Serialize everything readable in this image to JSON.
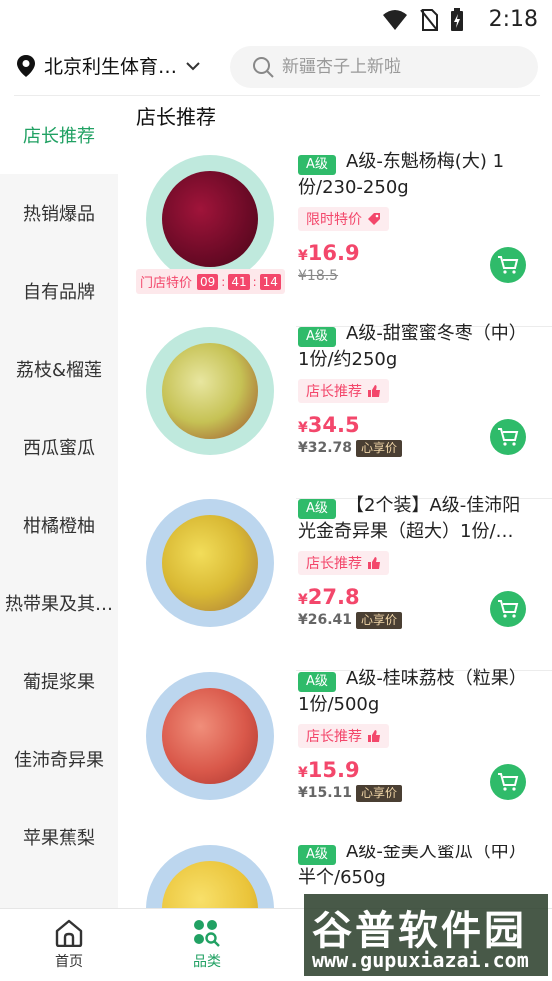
{
  "status_bar": {
    "time": "2:18"
  },
  "header": {
    "location": "北京利生体育…",
    "search_placeholder": "新疆杏子上新啦"
  },
  "sidebar": {
    "items": [
      {
        "label": "店长推荐",
        "active": true
      },
      {
        "label": "热销爆品"
      },
      {
        "label": "自有品牌"
      },
      {
        "label": "荔枝&榴莲"
      },
      {
        "label": "西瓜蜜瓜"
      },
      {
        "label": "柑橘橙柚"
      },
      {
        "label": "热带果及其…"
      },
      {
        "label": "葡提浆果"
      },
      {
        "label": "佳沛奇异果"
      },
      {
        "label": "苹果蕉梨"
      }
    ]
  },
  "main": {
    "section_title": "店长推荐",
    "products": [
      {
        "grade": "A级",
        "title": "A级-东魁杨梅(大) 1份/230-250g",
        "tag": "限时特价",
        "price": "16.9",
        "old_price": "¥18.5",
        "currency": "¥",
        "flash": {
          "label": "门店特价",
          "h": "09",
          "m": "41",
          "s": "14"
        }
      },
      {
        "grade": "A级",
        "title": "A级-甜蜜蜜冬枣（中）1份/约250g",
        "tag": "店长推荐",
        "price": "34.5",
        "vip_price": "¥32.78",
        "vip_label": "心享价",
        "currency": "¥"
      },
      {
        "grade": "A级",
        "title": "【2个装】A级-佳沛阳光金奇异果（超大）1份/…",
        "tag": "店长推荐",
        "price": "27.8",
        "vip_price": "¥26.41",
        "vip_label": "心享价",
        "currency": "¥"
      },
      {
        "grade": "A级",
        "title": "A级-桂味荔枝（粒果）1份/500g",
        "tag": "店长推荐",
        "price": "15.9",
        "vip_price": "¥15.11",
        "vip_label": "心享价",
        "currency": "¥"
      },
      {
        "grade": "A级",
        "title": "A级-金美人蜜瓜（中）半个/650g"
      }
    ]
  },
  "bottom_nav": {
    "items": [
      {
        "label": "首页"
      },
      {
        "label": "品类",
        "active": true
      }
    ]
  },
  "watermark": {
    "main": "谷普软件园",
    "url": "www.gupuxiazai.com"
  },
  "colors": {
    "brand_green": "#21a163",
    "price_red": "#f3476b"
  }
}
